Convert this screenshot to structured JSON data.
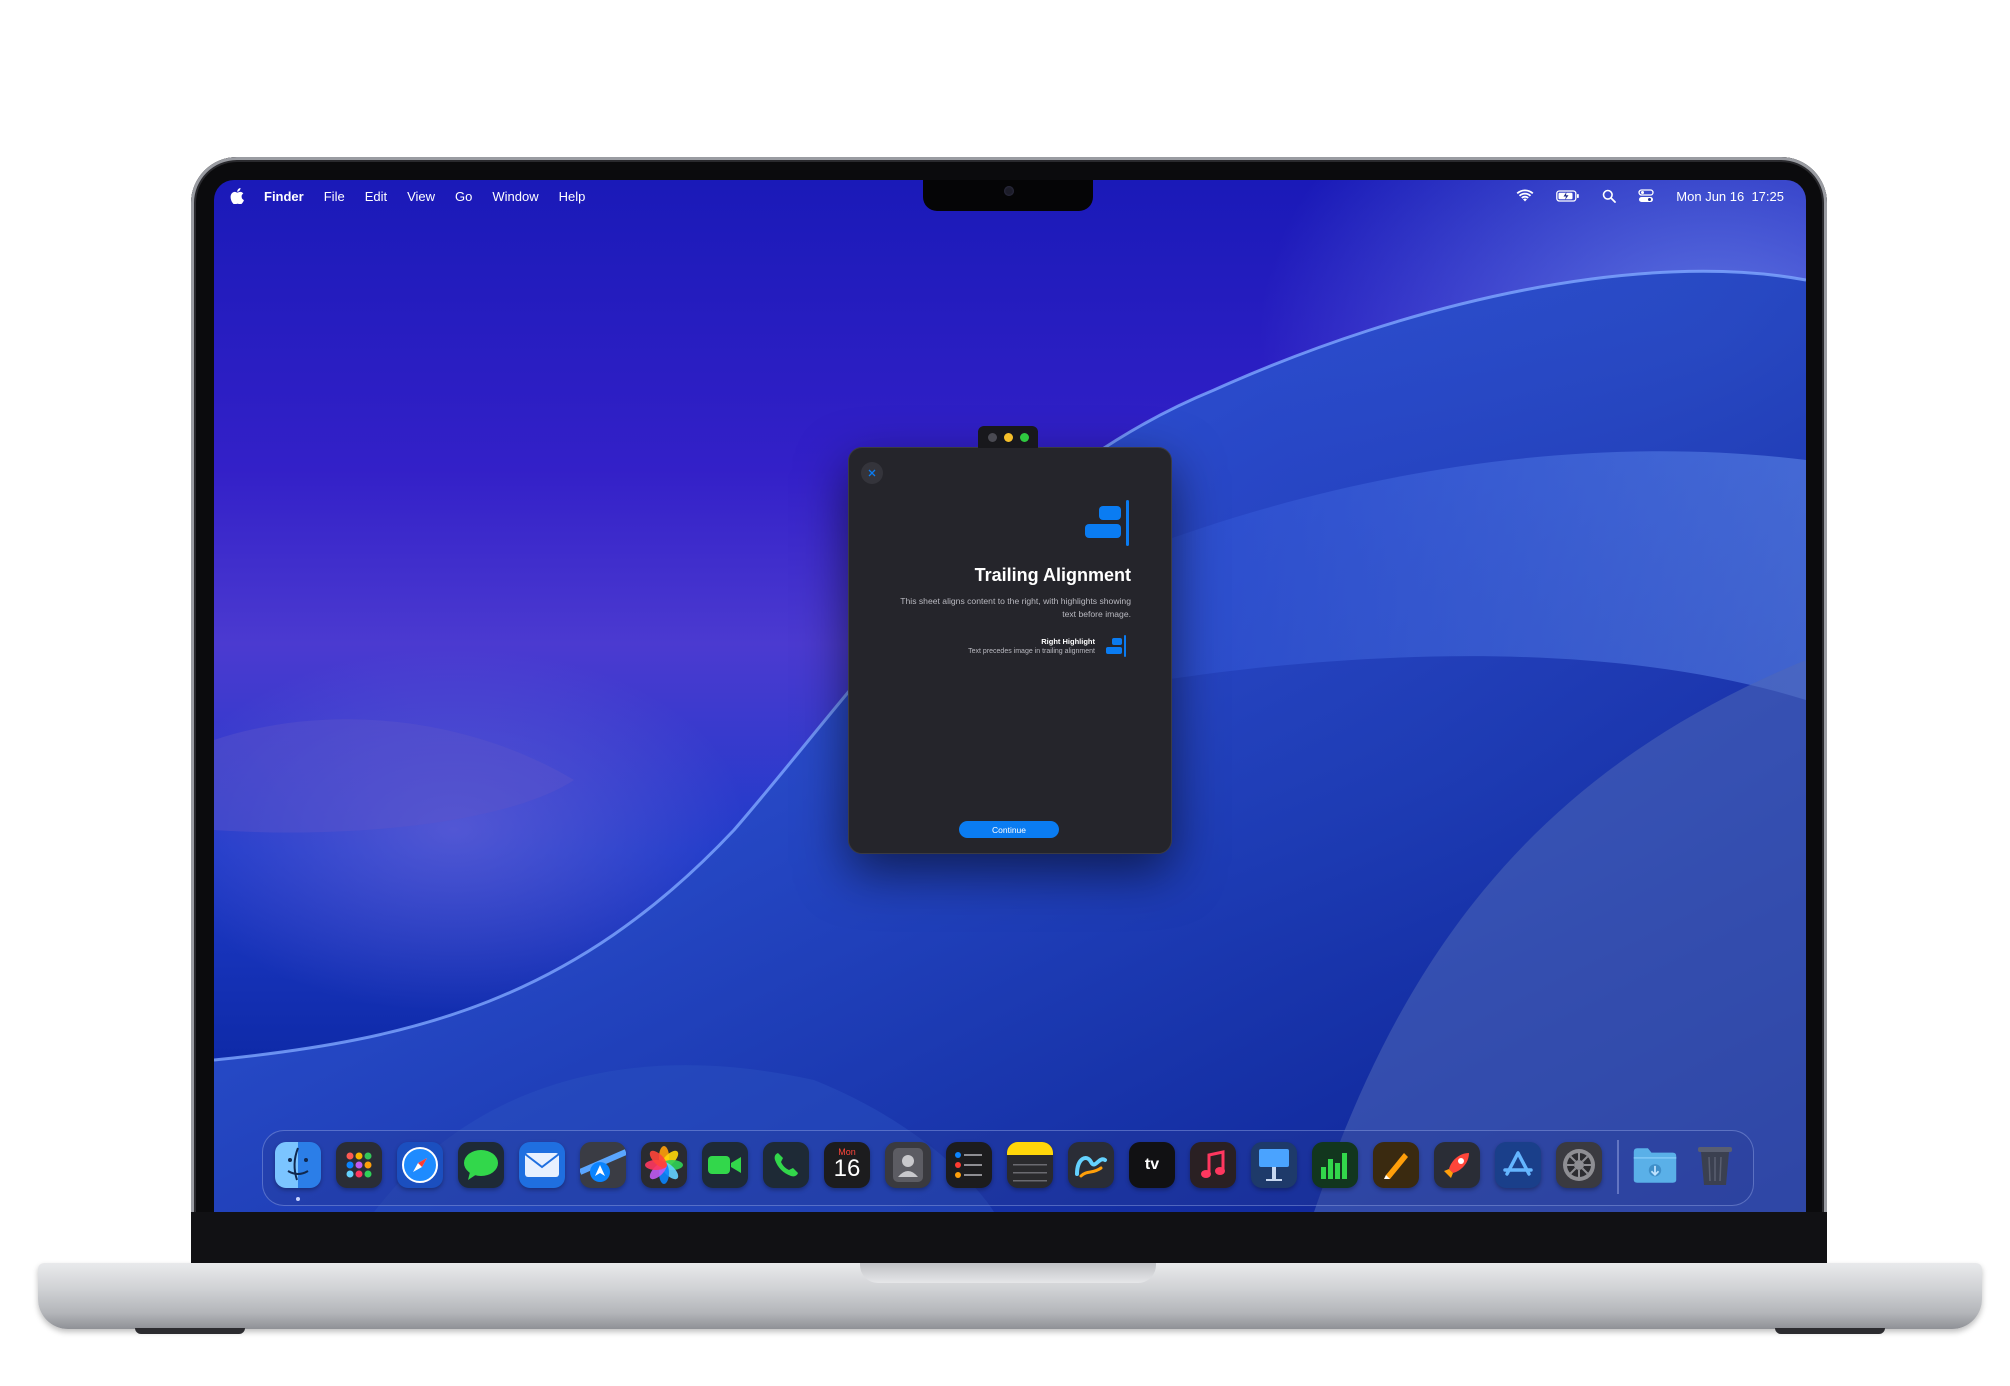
{
  "menubar": {
    "app_name": "Finder",
    "menus": [
      "File",
      "Edit",
      "View",
      "Go",
      "Window",
      "Help"
    ],
    "clock": "Mon Jun 16  17:25",
    "status_icons": [
      "wifi-icon",
      "battery-icon",
      "spotlight-icon",
      "control-center-icon"
    ]
  },
  "dialog": {
    "title": "Trailing Alignment",
    "description": "This sheet aligns content to the right, with highlights showing text before image.",
    "highlight_title": "Right Highlight",
    "highlight_subtitle": "Text precedes image in trailing alignment",
    "continue_label": "Continue",
    "accent": "#0a7cf2"
  },
  "dock": {
    "calendar_month": "Mon",
    "calendar_day": "16",
    "tv_label": "tv",
    "apps": [
      "Finder",
      "Launchpad",
      "Safari",
      "Messages",
      "Mail",
      "Maps",
      "Photos",
      "FaceTime",
      "Phone",
      "Calendar",
      "Contacts",
      "Reminders",
      "Notes",
      "Freeform",
      "TV",
      "Music",
      "Keynote",
      "Numbers",
      "Pages",
      "Rocket",
      "App Store",
      "System Settings",
      "Downloads",
      "Trash"
    ]
  }
}
